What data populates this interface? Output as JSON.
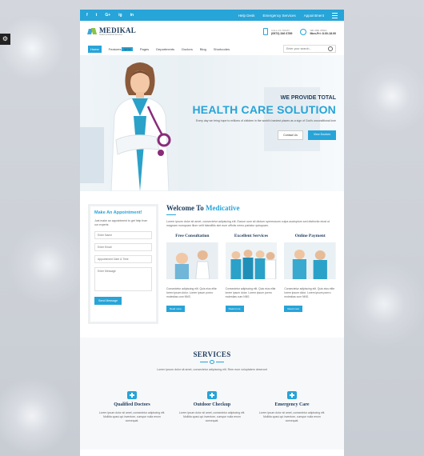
{
  "side_tab": {
    "icon": "sliders-icon",
    "glyph": "⚙"
  },
  "topbar": {
    "socials": [
      "f",
      "t",
      "G+",
      "ig",
      "in"
    ],
    "links": [
      "Help Desk",
      "Emergency Services",
      "Appointment"
    ]
  },
  "header": {
    "logo_text": "MEDIKAL",
    "logo_tagline": "Health & Medical Services",
    "call_label": "CALL US TODAY",
    "call_value": "(0972) 346 6789",
    "hours_label": "WE ARE OPEN",
    "hours_value": "Mon-Fri: 8.00-18.00"
  },
  "nav": {
    "items": [
      {
        "label": "Home",
        "active": true
      },
      {
        "label": "Features",
        "badge": "NEW"
      },
      {
        "label": "Pages"
      },
      {
        "label": "Departments"
      },
      {
        "label": "Doctors"
      },
      {
        "label": "Blog"
      },
      {
        "label": "Shortcodes"
      }
    ],
    "search_placeholder": "Enter your search..."
  },
  "hero": {
    "pretitle": "WE PROVIDE TOTAL",
    "title": "HEALTH CARE SOLUTION",
    "subtitle": "Every day we bring hope to millions of children in the world's hardest places as a sign of God's unconditional love",
    "btn_contact": "Contact Us",
    "btn_doctors": "View Doctors"
  },
  "appointment": {
    "title": "Make An Appointment!",
    "desc": "Just make an appointment to get help from our experts",
    "name_placeholder": "Enter Name",
    "email_placeholder": "Enter Email",
    "date_placeholder": "Appointment Date & Time",
    "message_placeholder": "Enter Message",
    "submit": "Send Message"
  },
  "welcome": {
    "title_prefix": "Welcome To ",
    "title_highlight": "Medicative",
    "body": "Lorem ipsum dolor sit amet, consectetur adipiscing elit. Earum sum sit dictum spermosum culpa aosisptum sed distinctio eiust ut magnam numquam illum velit blanditiis sint eum officiis nemo pariatur quisquam."
  },
  "cards": [
    {
      "title": "Free Consultation",
      "body": "Consectetur adipiscing elit. Quis eius elite lorem ipsum dolor. Lorem ipsum porrro molestias cum NNS.",
      "btn": "Read more"
    },
    {
      "title": "Excellent Services",
      "body": "Consectetur adipiscing elit. Quis eius elite lorem ipsum dolor. Lorem ipsum porrro molestias cum NNS.",
      "btn": "Read more"
    },
    {
      "title": "Online Payment",
      "body": "Consectetur adipiscing elit. Quis eius elite lorem ipsum dolor. Lorem ipsum porrro molestias cum NNS.",
      "btn": "Read more"
    }
  ],
  "services": {
    "title": "SERVICES",
    "body": "Lorem ipsum dolor sit amet, consectetur adipiscing elit. Rem eum voluptatem deserunt",
    "items": [
      {
        "name": "Qualified Doctors",
        "desc": "Lorem ipsum dolor sit amet, consectetur adipiscing elit. Mollitia quasi qui inventore, cumque nulla rerum consequat."
      },
      {
        "name": "Outdoor Checkup",
        "desc": "Lorem ipsum dolor sit amet, consectetur adipiscing elit. Mollitia quasi qui inventore, cumque nulla rerum consequat."
      },
      {
        "name": "Emergency Care",
        "desc": "Lorem ipsum dolor sit amet, consectetur adipiscing elit. Mollitia quasi qui inventore, cumque nulla rerum consequat."
      }
    ]
  },
  "colors": {
    "accent": "#27a4d8",
    "navy": "#1d3b5c",
    "green": "#8bc34a"
  }
}
